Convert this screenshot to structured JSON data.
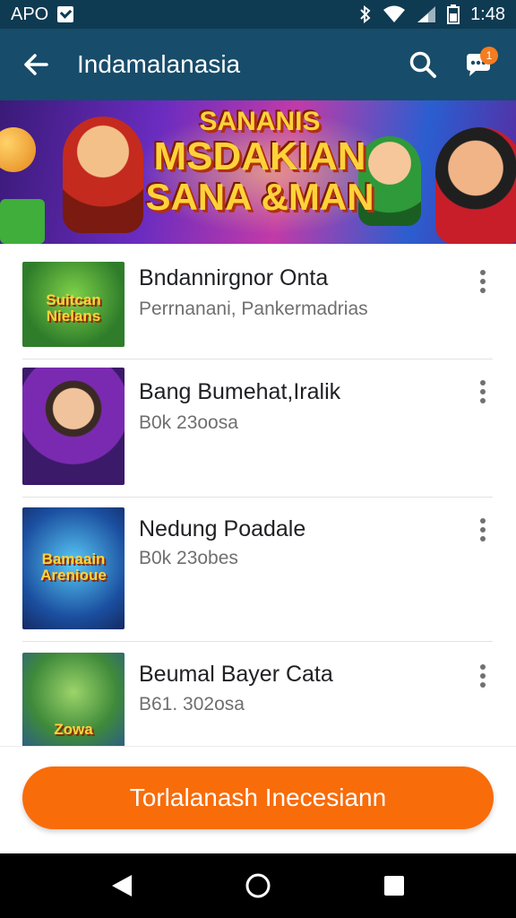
{
  "status_bar": {
    "carrier": "APO",
    "time": "1:48",
    "icons": [
      "app-notification-icon",
      "bluetooth-icon",
      "wifi-icon",
      "signal-icon",
      "battery-icon"
    ]
  },
  "app_bar": {
    "title": "Indamalanasia",
    "back_icon": "arrow-left-icon",
    "search_icon": "search-icon",
    "chat_icon": "chat-bubble-icon",
    "chat_badge": "1"
  },
  "banner": {
    "line1": "SANANIS",
    "line2": "MSDAKIAN",
    "line3": "SANA &MAN"
  },
  "list": {
    "items": [
      {
        "title": "Bndannirgnor Onta",
        "subtitle": "Perrnanani, Pankermadrias",
        "thumb_text": "Suitcan Nielans"
      },
      {
        "title": "Bang Bumehat,Iralik",
        "subtitle": "B0k 23oosa",
        "thumb_text": ""
      },
      {
        "title": "Nedung Poadale",
        "subtitle": "B0k 23obes",
        "thumb_text": "Bamaain Arenioue"
      },
      {
        "title": "Beumal Bayer Cata",
        "subtitle": "B61. 302osa",
        "thumb_text": "Zowa"
      }
    ]
  },
  "cta": {
    "label": "Torlalanash Inecesiann"
  },
  "colors": {
    "status_bar": "#0e3a52",
    "app_bar": "#174c6a",
    "accent": "#f86c0a",
    "badge": "#f57c1f"
  }
}
